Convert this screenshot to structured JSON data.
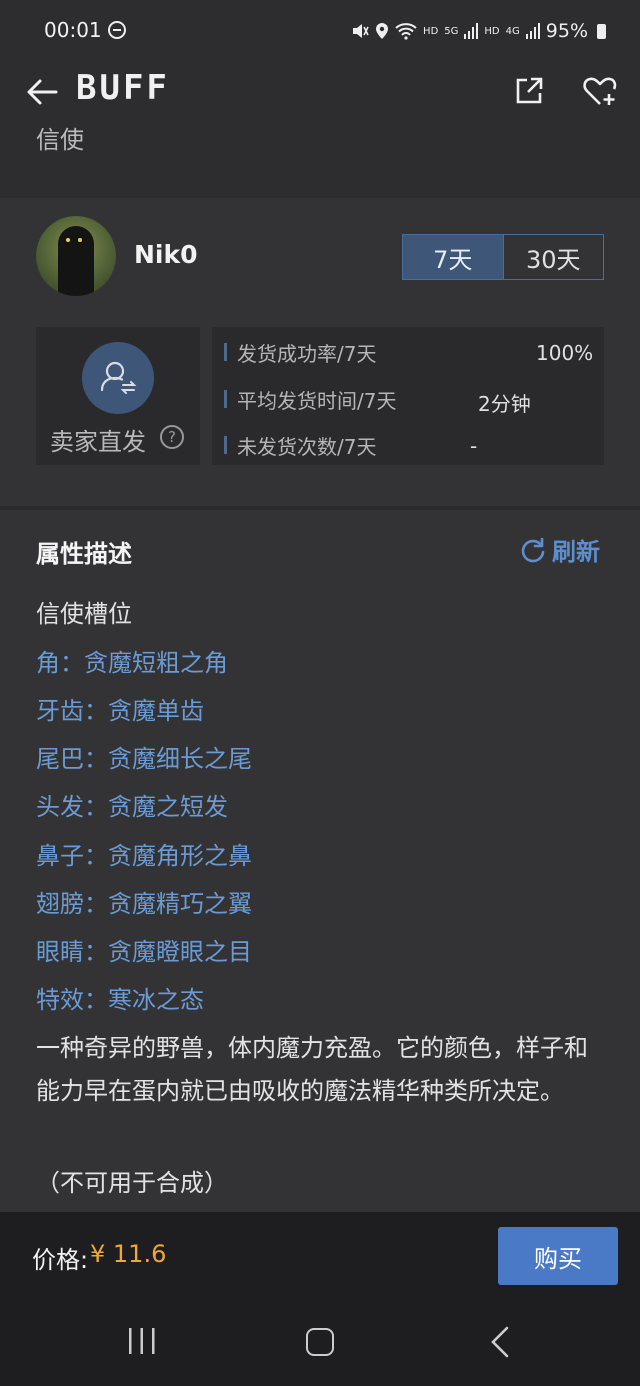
{
  "status_bar": {
    "time": "00:01",
    "network_hd1": "HD",
    "network_5g": "5G",
    "network_hd2": "HD",
    "network_4g": "4G",
    "battery": "95%"
  },
  "header": {
    "logo": "BUFF"
  },
  "partial_title": "信使",
  "seller": {
    "name": "Nik0",
    "periods": [
      "7天",
      "30天"
    ],
    "active_period": "7天",
    "direct_label": "卖家直发",
    "help_symbol": "?",
    "stats": [
      {
        "label": "发货成功率/7天",
        "value": "100%"
      },
      {
        "label": "平均发货时间/7天",
        "value": "2分钟"
      },
      {
        "label": "未发货次数/7天",
        "value": "-"
      }
    ]
  },
  "attributes": {
    "title": "属性描述",
    "refresh_label": "刷新",
    "slot_label": "信使槽位",
    "items": [
      "角：贪魔短粗之角",
      "牙齿：贪魔单齿",
      "尾巴：贪魔细长之尾",
      "头发：贪魔之短发",
      "鼻子：贪魔角形之鼻",
      "翅膀：贪魔精巧之翼",
      "眼睛：贪魔瞪眼之目",
      "特效：寒冰之态"
    ],
    "description": "一种奇异的野兽，体内魔力充盈。它的颜色，样子和能力早在蛋内就已由吸收的魔法精华种类所决定。",
    "note": "（不可用于合成）"
  },
  "footer": {
    "price_label": "价格:",
    "price_value": "¥ 11.6",
    "buy_label": "购买"
  },
  "colors": {
    "accent_blue": "#4a79c6",
    "attr_blue": "#6b9bd4",
    "price_orange": "#f0a830"
  }
}
